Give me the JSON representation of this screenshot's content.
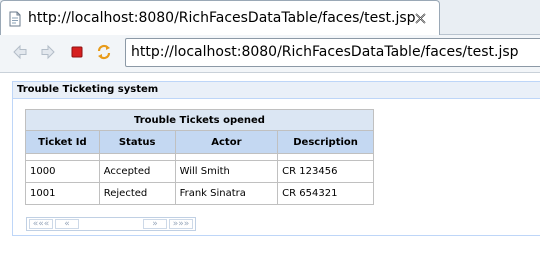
{
  "browser": {
    "tab_title": "http://localhost:8080/RichFacesDataTable/faces/test.jsp",
    "url": "http://localhost:8080/RichFacesDataTable/faces/test.jsp"
  },
  "panel": {
    "title": "Trouble Ticketing system"
  },
  "table": {
    "caption": "Trouble Tickets opened",
    "columns": [
      "Ticket Id",
      "Status",
      "Actor",
      "Description"
    ],
    "rows": [
      [
        "1000",
        "Accepted",
        "Will Smith",
        "CR 123456"
      ],
      [
        "1001",
        "Rejected",
        "Frank Sinatra",
        "CR 654321"
      ]
    ]
  },
  "pager": {
    "first": "«««",
    "prev": "«",
    "next": "»",
    "last": "»»»"
  },
  "colors": {
    "panel_header_bg": "#eaf0f8",
    "column_header_bg": "#c4d8f2",
    "caption_bg": "#dbe6f3",
    "panel_border": "#bed6f8",
    "stop_button": "#d61f1f"
  }
}
